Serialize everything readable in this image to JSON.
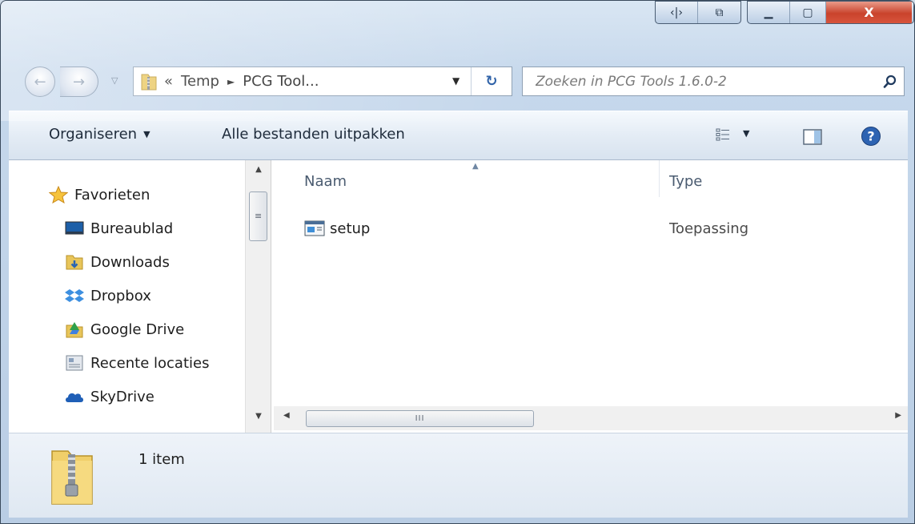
{
  "window": {
    "caption_buttons": [
      {
        "name": "snap-icon",
        "glyph": "‹|›"
      },
      {
        "name": "window-icon",
        "glyph": "⧉"
      },
      {
        "name": "minimize-icon",
        "glyph": "▁"
      },
      {
        "name": "maximize-icon",
        "glyph": "▢"
      },
      {
        "name": "close-icon",
        "glyph": "X"
      }
    ]
  },
  "nav": {
    "back_icon": "arrow-left-icon",
    "forward_icon": "arrow-right-icon",
    "history_icon": "chevron-down-icon"
  },
  "address": {
    "overflow": "«",
    "segments": [
      "Temp",
      "PCG Tool..."
    ],
    "separator": "►",
    "dropdown_glyph": "▼",
    "refresh_glyph": "↻"
  },
  "search": {
    "placeholder": "Zoeken in PCG Tools 1.6.0-2"
  },
  "toolbar": {
    "organize_label": "Organiseren",
    "organize_arrow": "▼",
    "extract_label": "Alle bestanden uitpakken",
    "view_arrow": "▼"
  },
  "nav_pane": {
    "items": [
      {
        "label": "Favorieten",
        "icon": "star-icon"
      },
      {
        "label": "Bureaublad",
        "icon": "desktop-icon"
      },
      {
        "label": "Downloads",
        "icon": "downloads-folder-icon"
      },
      {
        "label": "Dropbox",
        "icon": "dropbox-icon"
      },
      {
        "label": "Google Drive",
        "icon": "google-drive-icon"
      },
      {
        "label": "Recente locaties",
        "icon": "recent-places-icon"
      },
      {
        "label": "SkyDrive",
        "icon": "skydrive-icon"
      }
    ]
  },
  "file_list": {
    "columns": [
      "Naam",
      "Type"
    ],
    "rows": [
      {
        "name": "setup",
        "type": "Toepassing",
        "icon": "application-icon"
      }
    ],
    "hscroll_grip": "III"
  },
  "details": {
    "text": "1 item",
    "icon": "zip-folder-icon"
  },
  "colors": {
    "accent": "#2a5ea6",
    "close_button": "#c9432c",
    "folder": "#e8c55a"
  }
}
